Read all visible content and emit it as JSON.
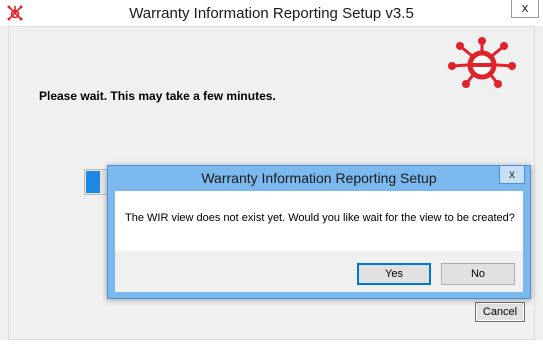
{
  "window": {
    "title": "Warranty Information Reporting Setup v3.5",
    "close_glyph": "x",
    "icon": "app-logo-icon"
  },
  "main": {
    "wait_message": "Please wait. This may take a few minutes.",
    "cancel_label": "Cancel",
    "progress_fraction": 0.04,
    "logo": "brand-logo-icon"
  },
  "dialog": {
    "title": "Warranty Information Reporting Setup",
    "close_glyph": "x",
    "message": "The WIR view does not exist yet. Would you like wait for the view to be created?",
    "yes_label": "Yes",
    "no_label": "No"
  },
  "colors": {
    "brand_red": "#e0222a",
    "progress_blue": "#1e88e5",
    "dialog_frame": "#7ab8ee"
  }
}
